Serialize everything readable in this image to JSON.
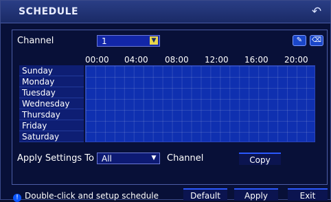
{
  "window": {
    "title": "SCHEDULE",
    "back_icon": "back-arrow-icon"
  },
  "channel": {
    "label": "Channel",
    "value": "1"
  },
  "tools": {
    "edit_icon": "pencil-icon",
    "erase_icon": "eraser-icon"
  },
  "grid": {
    "hours": [
      "00:00",
      "04:00",
      "08:00",
      "12:00",
      "16:00",
      "20:00"
    ],
    "days": [
      "Sunday",
      "Monday",
      "Tuesday",
      "Wednesday",
      "Thursday",
      "Friday",
      "Saturday"
    ]
  },
  "apply_settings": {
    "label": "Apply Settings To",
    "value": "All",
    "channel_label": "Channel",
    "copy_label": "Copy"
  },
  "footer": {
    "hint_icon": "info-icon",
    "hint_text": "Double-click and setup schedule",
    "default_label": "Default",
    "apply_label": "Apply",
    "exit_label": "Exit"
  }
}
